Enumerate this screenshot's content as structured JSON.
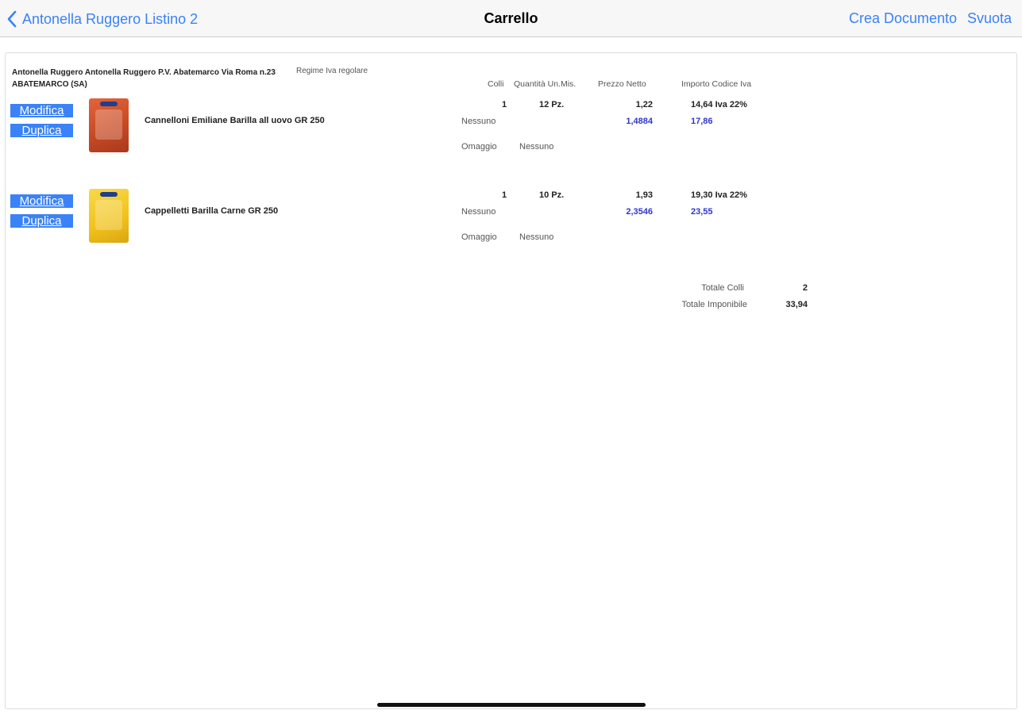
{
  "nav": {
    "back_label": "Antonella Ruggero Listino 2",
    "title": "Carrello",
    "crea_label": "Crea Documento",
    "svuota_label": "Svuota",
    "accent_color": "#3a82f7"
  },
  "customer": {
    "name": "Antonella Ruggero Antonella Ruggero P.V. Abatemarco Via Roma n.23 ABATEMARCO (SA)",
    "regime": "Regime Iva regolare"
  },
  "columns": {
    "colli": "Colli",
    "quantita_um": "Quantità Un.Mis.",
    "prezzo_netto": "Prezzo Netto",
    "importo_iva": "Importo Codice Iva"
  },
  "items": [
    {
      "modifica_label": "Modifica",
      "duplica_label": "Duplica",
      "name": "Cannelloni Emiliane Barilla all uovo GR 250",
      "colli": "1",
      "quantita": "12 Pz.",
      "prezzo": "1,22",
      "importo_iva": "14,64 Iva 22%",
      "sconto": "Nessuno",
      "prezzo_ivato": "1,4884",
      "importo_ivato": "17,86",
      "omaggio_label": "Omaggio",
      "omaggio_value": "Nessuno"
    },
    {
      "modifica_label": "Modifica",
      "duplica_label": "Duplica",
      "name": "Cappelletti Barilla Carne GR 250",
      "colli": "1",
      "quantita": "10 Pz.",
      "prezzo": "1,93",
      "importo_iva": "19,30 Iva 22%",
      "sconto": "Nessuno",
      "prezzo_ivato": "2,3546",
      "importo_ivato": "23,55",
      "omaggio_label": "Omaggio",
      "omaggio_value": "Nessuno"
    }
  ],
  "totals": {
    "colli_label": "Totale Colli",
    "colli_value": "2",
    "imponibile_label": "Totale Imponibile",
    "imponibile_value": "33,94"
  }
}
